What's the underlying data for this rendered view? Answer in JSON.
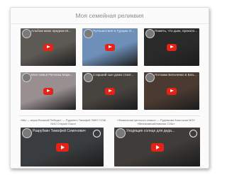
{
  "page": {
    "title": "Моя семейная реликвия"
  },
  "videos": [
    {
      "title": "Альбом моих предков М...",
      "bg": "#5d5a55"
    },
    {
      "title": "Путешествие в Турцию О...",
      "bg": "#6d8fb8"
    },
    {
      "title": "Память, что дьяк, прокопо...",
      "bg": "#2a2a2a"
    },
    {
      "title": "Моя семья Пепкова Марк...",
      "bg": "#9a8f90"
    },
    {
      "title": "Старший сын дома стоит...",
      "bg": "#47433f"
    },
    {
      "title": "Потомки Бельченко в Бла...",
      "bg": "#4a3a31"
    },
    {
      "title": "Разрубкин Тимофей Семенович",
      "bg": "#3a3d3f"
    },
    {
      "title": "Уходящие солнце для деда...",
      "bg": "#3f3c39"
    }
  ],
  "captions": {
    "left": "«Мы — внуки Великой Победы» — Рудкевич Тимофей ЗМКУ СОШ №10 Старый Оскол",
    "right": "«Фамильная ценность семьи» — Рудникова Анастасия МОУ «Великомихайловская СОШ»"
  },
  "colors": {
    "play": "#e62117",
    "card_bg": "#fbfbfb",
    "title": "#8c8c8c"
  }
}
